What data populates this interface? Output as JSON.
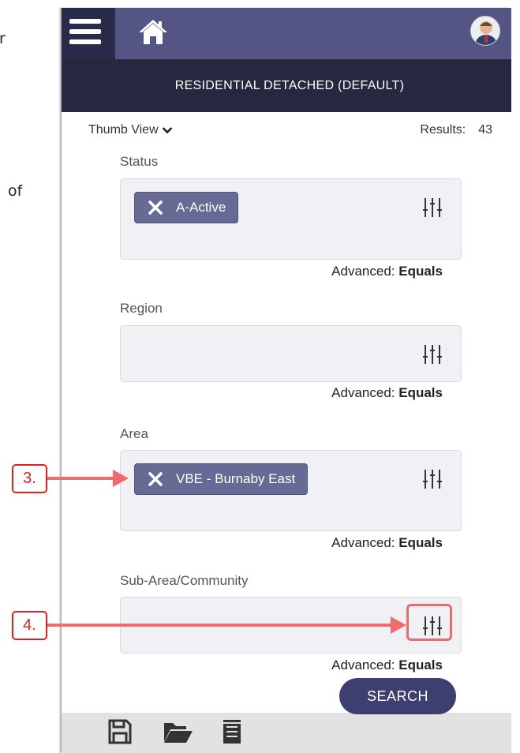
{
  "background_text": {
    "right_edge_1": "r",
    "right_edge_2": "of"
  },
  "header": {
    "title": "RESIDENTIAL DETACHED (DEFAULT)",
    "menu_icon": "hamburger-icon",
    "home_icon": "home-icon",
    "avatar_icon": "user-avatar"
  },
  "view": {
    "mode_label": "Thumb View",
    "results_label": "Results:",
    "results_count": "43"
  },
  "fields": {
    "status": {
      "label": "Status",
      "chip": "A-Active",
      "advanced_label": "Advanced:",
      "advanced_value": "Equals"
    },
    "region": {
      "label": "Region",
      "advanced_label": "Advanced:",
      "advanced_value": "Equals"
    },
    "area": {
      "label": "Area",
      "chip": "VBE - Burnaby East",
      "advanced_label": "Advanced:",
      "advanced_value": "Equals"
    },
    "subarea": {
      "label": "Sub-Area/Community",
      "advanced_label": "Advanced:",
      "advanced_value": "Equals"
    }
  },
  "footer": {
    "search_label": "SEARCH",
    "icons": [
      "save-icon",
      "folder-open-icon",
      "document-list-icon"
    ]
  },
  "callouts": {
    "step3": "3.",
    "step4": "4."
  },
  "colors": {
    "topbar": "#555585",
    "titlebar": "#26283f",
    "chip": "#676a95",
    "search_button": "#3d3f71",
    "callout": "#e02020"
  }
}
